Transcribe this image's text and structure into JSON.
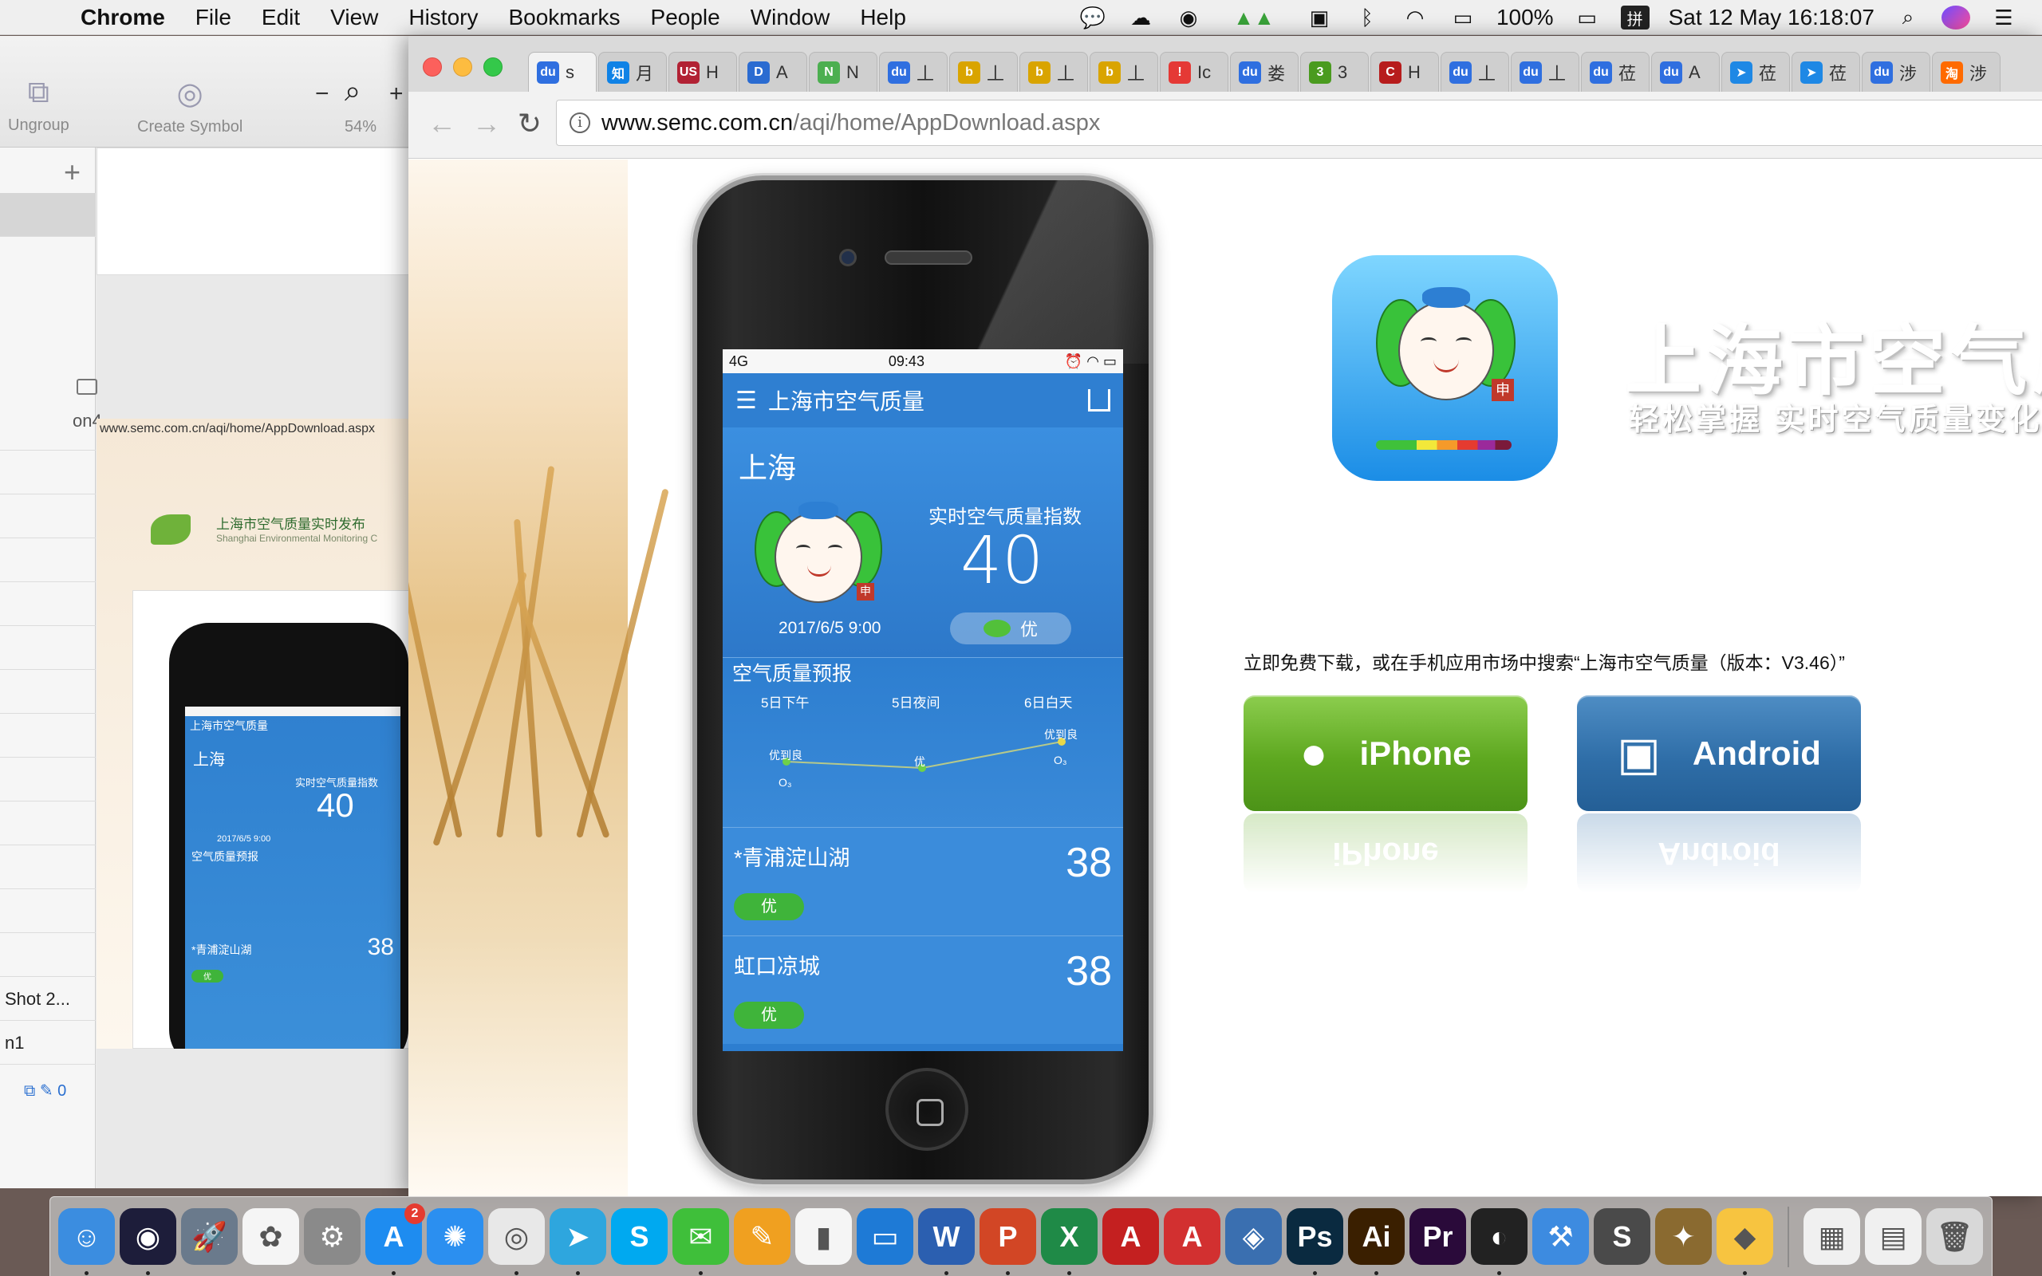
{
  "menubar": {
    "app": "Chrome",
    "items": [
      "File",
      "Edit",
      "View",
      "History",
      "Bookmarks",
      "People",
      "Window",
      "Help"
    ],
    "battery": "100%",
    "ime": "拼",
    "datetime": "Sat 12 May  16:18:07"
  },
  "sketch": {
    "tools": [
      "Ungroup",
      "Create Symbol"
    ],
    "zoom": "54%",
    "layer_partial": "on4",
    "row_shot": "Shot 2...",
    "row_n1": "n1",
    "count": "0",
    "mini_url": "www.semc.com.cn/aqi/home/AppDownload.aspx",
    "mini_header": "上海市空气质量实时发布",
    "mini_header_en": "Shanghai Environmental Monitoring C",
    "mini_app_title": "上海市空气质量",
    "mini_city": "上海",
    "mini_caption": "实时空气质量指数",
    "mini_aqi": "40",
    "mini_date": "2017/6/5 9:00",
    "mini_forecast": "空气质量预报",
    "mini_station": "*青浦淀山湖",
    "mini_station_value": "38",
    "mini_level": "优"
  },
  "browser": {
    "tabs": [
      {
        "fav": "du",
        "color": "#2f6fe0",
        "text": "s"
      },
      {
        "fav": "知",
        "color": "#0f82e6",
        "text": "月"
      },
      {
        "fav": "US",
        "color": "#b22234",
        "text": "H"
      },
      {
        "fav": "D",
        "color": "#2a6bd1",
        "text": "A"
      },
      {
        "fav": "N",
        "color": "#4caf50",
        "text": "N"
      },
      {
        "fav": "du",
        "color": "#2f6fe0",
        "text": "丄"
      },
      {
        "fav": "b",
        "color": "#d9a400",
        "text": "丄"
      },
      {
        "fav": "b",
        "color": "#d9a400",
        "text": "丄"
      },
      {
        "fav": "b",
        "color": "#d9a400",
        "text": "丄"
      },
      {
        "fav": "!",
        "color": "#e53935",
        "text": "Ic"
      },
      {
        "fav": "du",
        "color": "#2f6fe0",
        "text": "娄"
      },
      {
        "fav": "3",
        "color": "#4a9b1f",
        "text": "3"
      },
      {
        "fav": "C",
        "color": "#b71c1c",
        "text": "H"
      },
      {
        "fav": "du",
        "color": "#2f6fe0",
        "text": "丄"
      },
      {
        "fav": "du",
        "color": "#2f6fe0",
        "text": "丄"
      },
      {
        "fav": "du",
        "color": "#2f6fe0",
        "text": "莅"
      },
      {
        "fav": "du",
        "color": "#2f6fe0",
        "text": "A"
      },
      {
        "fav": "➤",
        "color": "#1e88e5",
        "text": "莅"
      },
      {
        "fav": "➤",
        "color": "#1e88e5",
        "text": "莅"
      },
      {
        "fav": "du",
        "color": "#2f6fe0",
        "text": "涉"
      },
      {
        "fav": "淘",
        "color": "#ff6a00",
        "text": "涉"
      }
    ],
    "url_host": "www.semc.com.cn",
    "url_path": "/aqi/home/AppDownload.aspx"
  },
  "phone": {
    "status_left": "4G",
    "status_time": "09:43",
    "app_title": "上海市空气质量",
    "city": "上海",
    "aqi_caption": "实时空气质量指数",
    "aqi_value": "40",
    "date": "2017/6/5 9:00",
    "aqi_level": "优",
    "forecast_title": "空气质量预报",
    "forecast_cols": [
      "5日下午",
      "5日夜间",
      "6日白天"
    ],
    "forecast_levels": [
      "优到良",
      "优",
      "优到良"
    ],
    "forecast_pollutant": "O₃",
    "stations": [
      {
        "name": "*青浦淀山湖",
        "value": "38",
        "level": "优"
      },
      {
        "name": "虹口凉城",
        "value": "38",
        "level": "优"
      }
    ]
  },
  "page": {
    "title": "上海市空气质",
    "subtitle": "轻松掌握 实时空气质量变化",
    "download_text": "立即免费下载，或在手机应用市场中搜索“上海市空气质量（版本：V3.46）”",
    "btn_iphone": "iPhone",
    "btn_android": "Android",
    "stamp": "申"
  },
  "dock": [
    {
      "name": "finder-icon",
      "bg": "#3b8de0",
      "glyph": "☺"
    },
    {
      "name": "siri-icon",
      "bg": "#1d1d3a",
      "glyph": "◉"
    },
    {
      "name": "launchpad-icon",
      "bg": "#6a7a8c",
      "glyph": "🚀"
    },
    {
      "name": "photos-icon",
      "bg": "#f5f5f5",
      "glyph": "✿"
    },
    {
      "name": "system-preferences-icon",
      "bg": "#8a8a8a",
      "glyph": "⚙"
    },
    {
      "name": "app-store-icon",
      "bg": "#1e8cf0",
      "glyph": "A",
      "badge": "2"
    },
    {
      "name": "safari-icon",
      "bg": "#2b8ff0",
      "glyph": "✺"
    },
    {
      "name": "chrome-icon",
      "bg": "#e8e8e8",
      "glyph": "◎"
    },
    {
      "name": "telegram-icon",
      "bg": "#2ea6de",
      "glyph": "➤"
    },
    {
      "name": "skype-icon",
      "bg": "#00a9f0",
      "glyph": "S"
    },
    {
      "name": "wechat-icon",
      "bg": "#3fbf3a",
      "glyph": "✉"
    },
    {
      "name": "pages-icon",
      "bg": "#f0a020",
      "glyph": "✎"
    },
    {
      "name": "numbers-icon",
      "bg": "#f5f5f5",
      "glyph": "▮"
    },
    {
      "name": "keynote-icon",
      "bg": "#1e7ad6",
      "glyph": "▭"
    },
    {
      "name": "word-icon",
      "bg": "#2b5fb0",
      "glyph": "W"
    },
    {
      "name": "powerpoint-icon",
      "bg": "#d24625",
      "glyph": "P"
    },
    {
      "name": "excel-icon",
      "bg": "#1f8a47",
      "glyph": "X"
    },
    {
      "name": "autocad-icon",
      "bg": "#c42020",
      "glyph": "A"
    },
    {
      "name": "autocad-ws-icon",
      "bg": "#d23030",
      "glyph": "A"
    },
    {
      "name": "aperture-icon",
      "bg": "#3a6fb0",
      "glyph": "◈"
    },
    {
      "name": "photoshop-icon",
      "bg": "#0a2a40",
      "glyph": "Ps"
    },
    {
      "name": "illustrator-icon",
      "bg": "#3a1f00",
      "glyph": "Ai"
    },
    {
      "name": "premiere-icon",
      "bg": "#2a0a3a",
      "glyph": "Pr"
    },
    {
      "name": "logic-icon",
      "bg": "#222222",
      "glyph": "◐"
    },
    {
      "name": "xcode-icon",
      "bg": "#3d8be0",
      "glyph": "⚒"
    },
    {
      "name": "sublime-icon",
      "bg": "#4a4a4a",
      "glyph": "S"
    },
    {
      "name": "hearthstone-icon",
      "bg": "#8a6a30",
      "glyph": "✦"
    },
    {
      "name": "sketch-icon",
      "bg": "#f7c440",
      "glyph": "◆"
    },
    {
      "name": "downloads-stack-icon",
      "bg": "#f0f0f0",
      "glyph": "▦"
    },
    {
      "name": "documents-stack-icon",
      "bg": "#f0f0f0",
      "glyph": "▤"
    },
    {
      "name": "trash-icon",
      "bg": "#d8d8d8",
      "glyph": "🗑"
    }
  ]
}
